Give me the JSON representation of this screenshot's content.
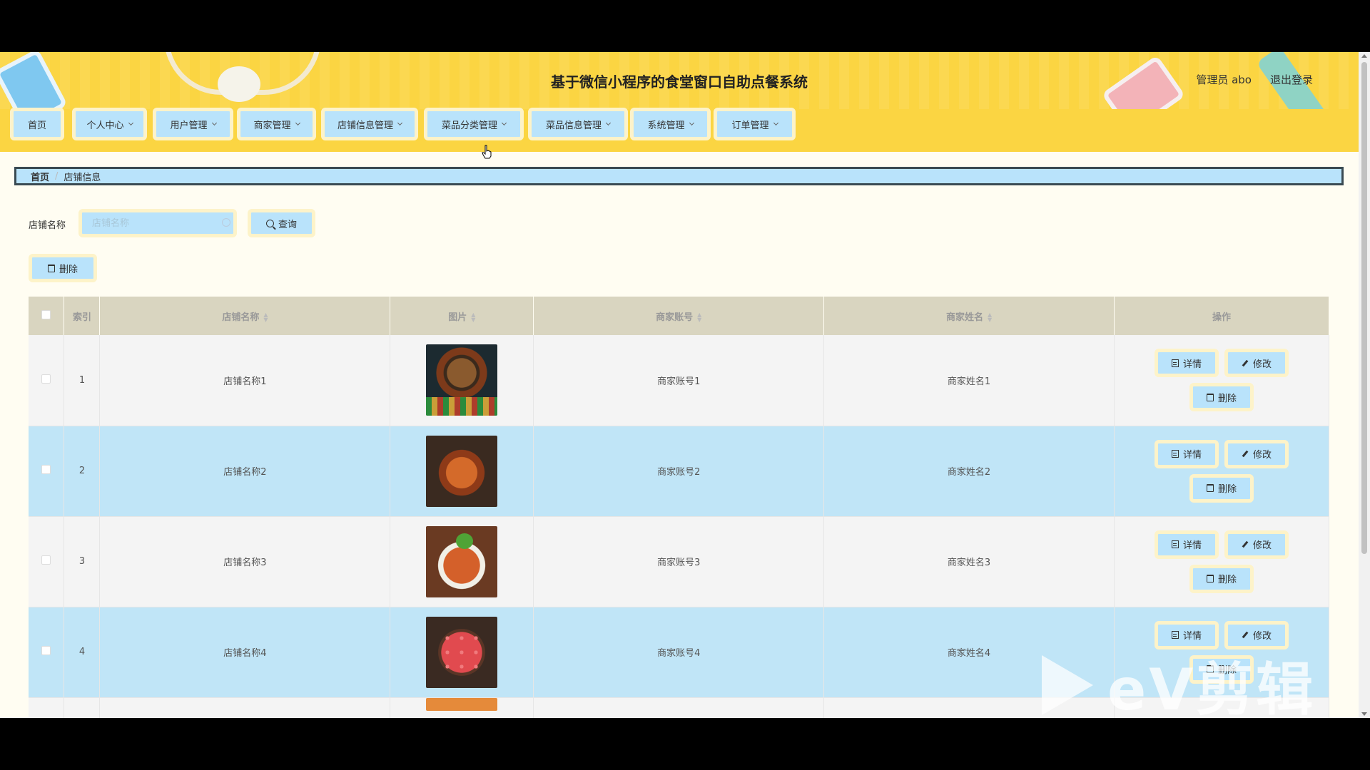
{
  "header": {
    "title": "基于微信小程序的食堂窗口自助点餐系统",
    "user_label": "管理员 abo",
    "logout_label": "退出登录"
  },
  "nav": {
    "items": [
      {
        "label": "首页",
        "has_dropdown": false
      },
      {
        "label": "个人中心",
        "has_dropdown": true
      },
      {
        "label": "用户管理",
        "has_dropdown": true
      },
      {
        "label": "商家管理",
        "has_dropdown": true
      },
      {
        "label": "店铺信息管理",
        "has_dropdown": true
      },
      {
        "label": "菜品分类管理",
        "has_dropdown": true
      },
      {
        "label": "菜品信息管理",
        "has_dropdown": true
      },
      {
        "label": "系统管理",
        "has_dropdown": true
      },
      {
        "label": "订单管理",
        "has_dropdown": true
      }
    ]
  },
  "breadcrumb": {
    "home": "首页",
    "current": "店铺信息"
  },
  "search": {
    "label": "店铺名称",
    "placeholder": "店铺名称",
    "button_label": "查询"
  },
  "toolbar": {
    "delete_label": "删除"
  },
  "table": {
    "columns": {
      "index": "索引",
      "shop_name": "店铺名称",
      "image": "图片",
      "merchant_account": "商家账号",
      "merchant_name": "商家姓名",
      "actions": "操作"
    },
    "rows": [
      {
        "index": "1",
        "shop_name": "店铺名称1",
        "image": "burger-photo",
        "merchant_account": "商家账号1",
        "merchant_name": "商家姓名1"
      },
      {
        "index": "2",
        "shop_name": "店铺名称2",
        "image": "stew-photo",
        "merchant_account": "商家账号2",
        "merchant_name": "商家姓名2"
      },
      {
        "index": "3",
        "shop_name": "店铺名称3",
        "image": "crayfish-photo",
        "merchant_account": "商家账号3",
        "merchant_name": "商家姓名3"
      },
      {
        "index": "4",
        "shop_name": "店铺名称4",
        "image": "watermelon-photo",
        "merchant_account": "商家账号4",
        "merchant_name": "商家姓名4"
      }
    ],
    "actions": {
      "detail": "详情",
      "edit": "修改",
      "delete": "删除"
    }
  },
  "watermark": {
    "text": "eV剪辑"
  },
  "colors": {
    "header_bg": "#fbd542",
    "button_bg": "#b9e3fb",
    "button_border": "#fdf3c9",
    "table_header_bg": "#d9d5c0",
    "row_alt_bg": "#c0e5f7",
    "page_bg": "#fffdf2"
  }
}
